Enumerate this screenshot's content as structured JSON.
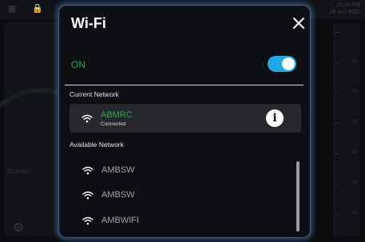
{
  "background": {
    "time": "10:30 PM",
    "date": "16 Jun 2023",
    "left_label": "10 mins",
    "scale_ticks": [
      "-",
      "-60",
      "-50",
      "-40",
      "-30",
      "-20",
      "-10"
    ]
  },
  "modal": {
    "title": "Wi-Fi",
    "toggle_label": "ON",
    "toggle_state": true,
    "current_section": "Current Network",
    "current_network": {
      "name": "ABMRC",
      "status": "Connected"
    },
    "available_section": "Available Network",
    "available_networks": [
      {
        "name": "AMBSW"
      },
      {
        "name": "AMBSW"
      },
      {
        "name": "AMBWIFI"
      }
    ]
  },
  "colors": {
    "accent_green": "#2fa84f",
    "toggle_blue": "#1da9e6",
    "modal_glow": "#4678b4"
  },
  "icons": {
    "close": "close-icon",
    "wifi": "wifi-icon",
    "info": "info-icon",
    "lock": "lock-icon",
    "gear": "gear-icon"
  }
}
